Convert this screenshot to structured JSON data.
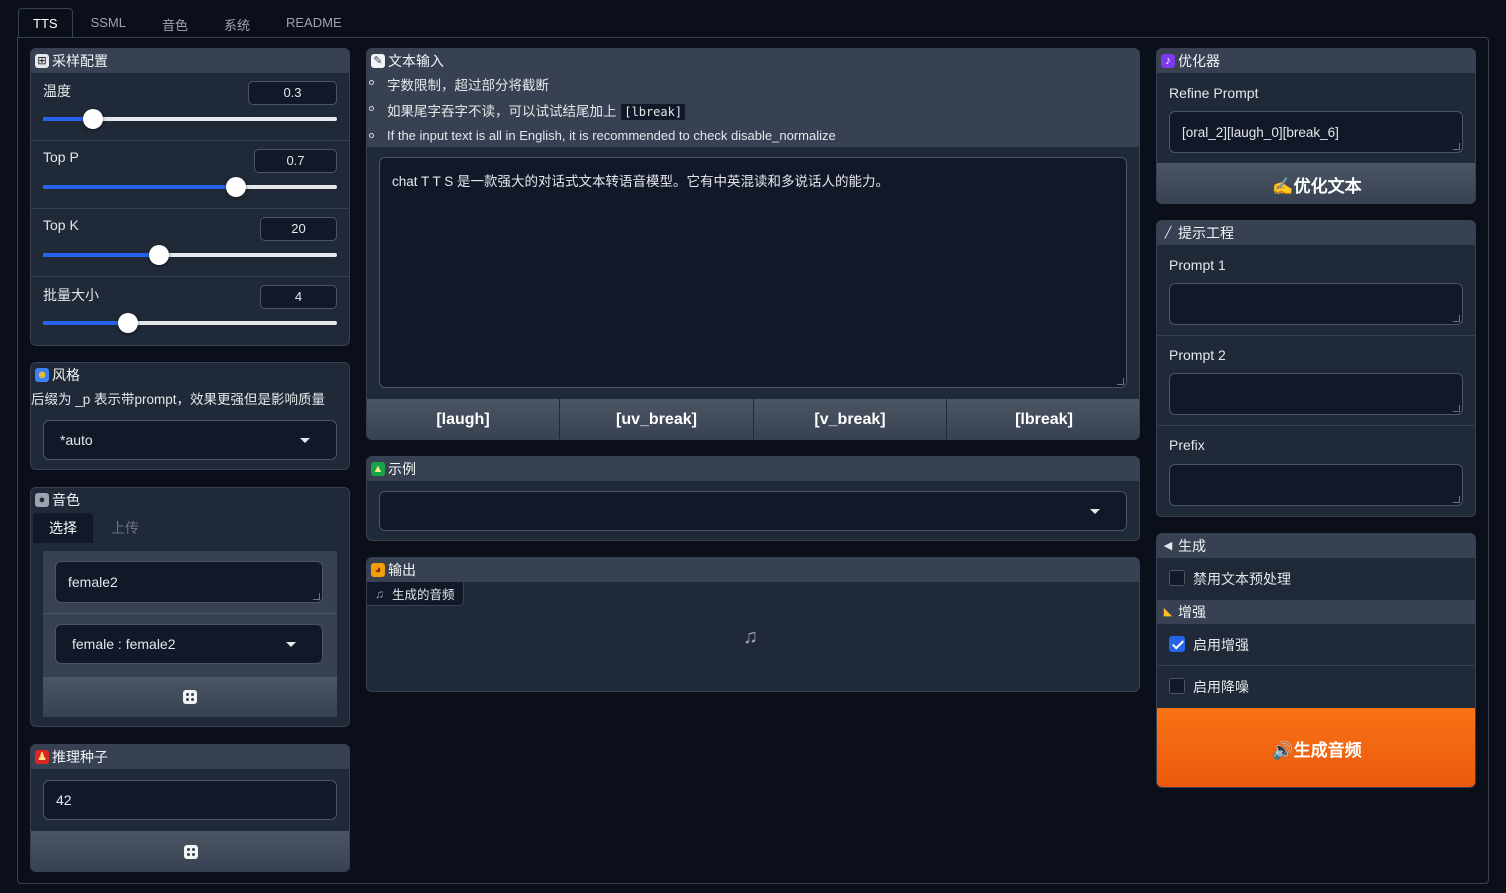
{
  "tabs": [
    "TTS",
    "SSML",
    "音色",
    "系统",
    "README"
  ],
  "sampling": {
    "title": "采样配置",
    "sliders": [
      {
        "label": "温度",
        "value": "0.3",
        "fraction": 0.17
      },
      {
        "label": "Top P",
        "value": "0.7",
        "fraction": 0.655
      },
      {
        "label": "Top K",
        "value": "20",
        "fraction": 0.395
      },
      {
        "label": "批量大小",
        "value": "4",
        "fraction": 0.29
      }
    ]
  },
  "style": {
    "title": "风格",
    "description": "后缀为 _p 表示带prompt，效果更强但是影响质量",
    "selected": "*auto"
  },
  "voice": {
    "title": "音色",
    "tabs": [
      "选择",
      "上传"
    ],
    "speaker_input": "female2",
    "speaker_select": "female : female2"
  },
  "seed": {
    "title": "推理种子",
    "value": "42"
  },
  "text_input": {
    "title": "文本输入",
    "notes": [
      "字数限制，超过部分将截断",
      "如果尾字吞字不读，可以试试结尾加上",
      "If the input text is all in English, it is recommended to check disable_normalize"
    ],
    "note_code": "[lbreak]",
    "text": "chat T T S 是一款强大的对话式文本转语音模型。它有中英混读和多说话人的能力。",
    "buttons": [
      "[laugh]",
      "[uv_break]",
      "[v_break]",
      "[lbreak]"
    ]
  },
  "examples": {
    "title": "示例",
    "selected": ""
  },
  "output": {
    "title": "输出",
    "audio_label": "生成的音频"
  },
  "optimizer": {
    "title": "优化器",
    "refine_label": "Refine Prompt",
    "refine_value": "[oral_2][laugh_0][break_6]",
    "button": "✍️优化文本"
  },
  "prompt_eng": {
    "title": "提示工程",
    "fields": [
      {
        "label": "Prompt 1",
        "value": ""
      },
      {
        "label": "Prompt 2",
        "value": ""
      },
      {
        "label": "Prefix",
        "value": ""
      }
    ]
  },
  "generate": {
    "title": "生成",
    "disable_normalize": "禁用文本预处理",
    "enhance_title": "增强",
    "enable_enhance": "启用增强",
    "enable_denoise": "启用降噪",
    "button": "🔊生成音频"
  },
  "colors": {
    "accent": "#2563eb",
    "primary_button": "#f97316",
    "panel": "#1f2937",
    "background": "#0b0f19"
  },
  "icons": {
    "sampling": "dice-grid-icon",
    "style": "mask-icon",
    "voice": "person-silhouette-icon",
    "seed": "dancer-icon",
    "text_input": "memo-icon",
    "examples": "tree-icon",
    "output": "palette-icon",
    "optimizer": "music-notes-icon",
    "prompt_eng": "wand-icon",
    "generate": "speaker-icon",
    "enhance": "flexed-arm-icon"
  }
}
